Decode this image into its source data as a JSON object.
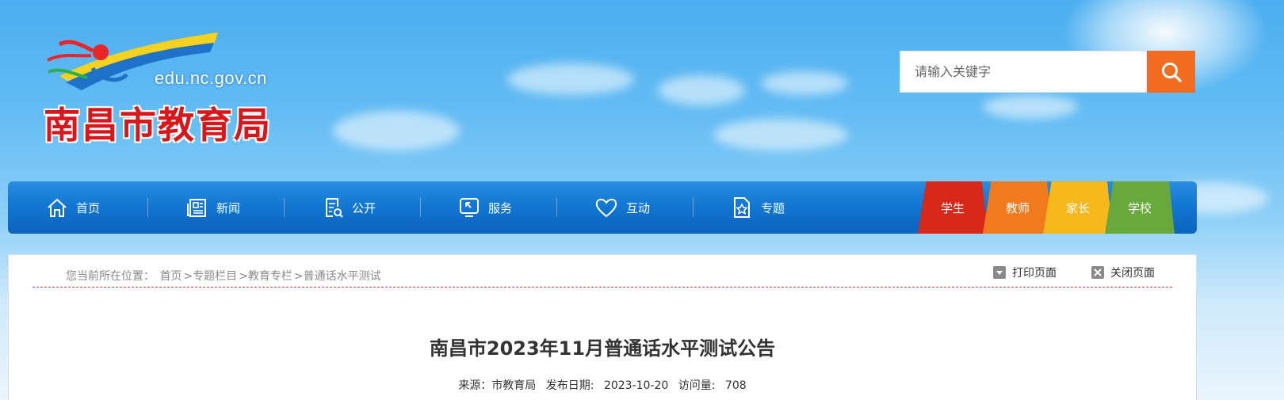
{
  "header": {
    "logo_domain": "edu.nc.gov.cn",
    "logo_name": "南昌市教育局",
    "search": {
      "placeholder": "请输入关键字",
      "icon": "search-icon"
    }
  },
  "nav": {
    "items": [
      {
        "label": "首页",
        "icon": "home-icon"
      },
      {
        "label": "新闻",
        "icon": "newspaper-icon"
      },
      {
        "label": "公开",
        "icon": "document-icon"
      },
      {
        "label": "服务",
        "icon": "service-icon"
      },
      {
        "label": "互动",
        "icon": "heart-icon"
      },
      {
        "label": "专题",
        "icon": "badge-icon"
      }
    ],
    "roles": [
      {
        "label": "学生",
        "color": "#d8281a"
      },
      {
        "label": "教师",
        "color": "#f07a1c"
      },
      {
        "label": "家长",
        "color": "#f6b81b"
      },
      {
        "label": "学校",
        "color": "#69a83c"
      }
    ]
  },
  "breadcrumb": {
    "prefix": "您当前所在位置：",
    "items": [
      "首页",
      "专题栏目",
      "教育专栏",
      "普通话水平测试"
    ]
  },
  "tools": {
    "print": "打印页面",
    "close": "关闭页面"
  },
  "article": {
    "title": "南昌市2023年11月普通话水平测试公告",
    "source_label": "来源：",
    "source": "市教育局",
    "date_label": "发布日期:",
    "date": "2023-10-20",
    "views_label": "访问量:",
    "views": "708"
  }
}
